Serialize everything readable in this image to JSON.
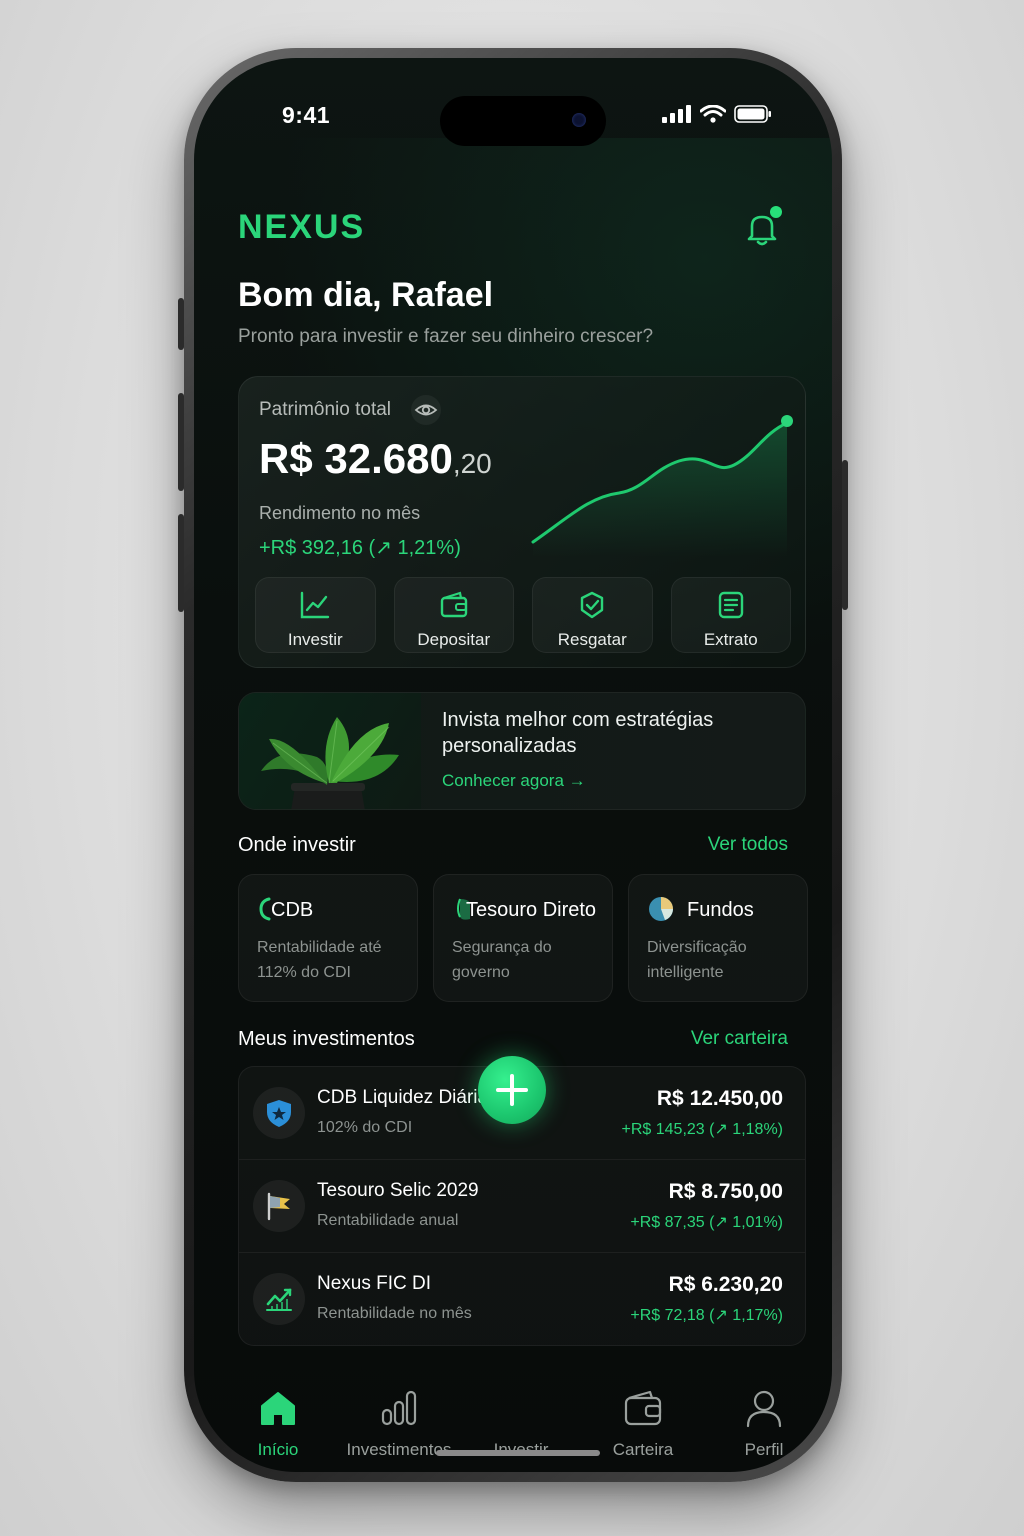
{
  "status": {
    "time": "9:41"
  },
  "app": {
    "brand": "NEXUS",
    "accent": "#2bd57a"
  },
  "header": {
    "greeting": "Bom dia, Rafael",
    "subtitle": "Pronto para investir e fazer seu dinheiro crescer?"
  },
  "portfolio": {
    "label": "Patrimônio total",
    "balance_main": "R$ 32.680",
    "balance_cents": ",20",
    "yield_label": "Rendimento no mês",
    "yield_value": "+R$ 392,16 (↗ 1,21%)",
    "trend_icon": "line-chart-trend"
  },
  "actions": [
    {
      "label": "Investir",
      "icon": "chart-up-icon"
    },
    {
      "label": "Depositar",
      "icon": "wallet-icon"
    },
    {
      "label": "Resgatar",
      "icon": "redeem-icon"
    },
    {
      "label": "Extrato",
      "icon": "statement-icon"
    }
  ],
  "promo": {
    "title": "Invista melhor com estratégias personalizadas",
    "link": "Conhecer agora →"
  },
  "where": {
    "title": "Onde investir",
    "link": "Ver todos",
    "cards": [
      {
        "name": "CDB",
        "desc": "Rentabilidade até 112% do CDI"
      },
      {
        "name": "Tesouro Direto",
        "desc": "Segurança do governo"
      },
      {
        "name": "Fundos",
        "desc": "Diversificação intelligente"
      }
    ]
  },
  "investments": {
    "title": "Meus investimentos",
    "link": "Ver carteira",
    "items": [
      {
        "name": "CDB Liquidez Diária",
        "sub": "102% do CDI",
        "value": "R$ 12.450,00",
        "gain": "+R$ 145,23 (↗ 1,18%)"
      },
      {
        "name": "Tesouro Selic 2029",
        "sub": "Rentabilidade anual",
        "value": "R$ 8.750,00",
        "gain": "+R$ 87,35 (↗ 1,01%)"
      },
      {
        "name": "Nexus FIC DI",
        "sub": "Rentabilidade no mês",
        "value": "R$ 6.230,20",
        "gain": "+R$ 72,18 (↗ 1,17%)"
      }
    ]
  },
  "tabbar": {
    "items": [
      {
        "label": "Início",
        "active": true
      },
      {
        "label": "Investimentos"
      },
      {
        "label": "Investir"
      },
      {
        "label": "Carteira"
      },
      {
        "label": "Perfil"
      }
    ]
  }
}
